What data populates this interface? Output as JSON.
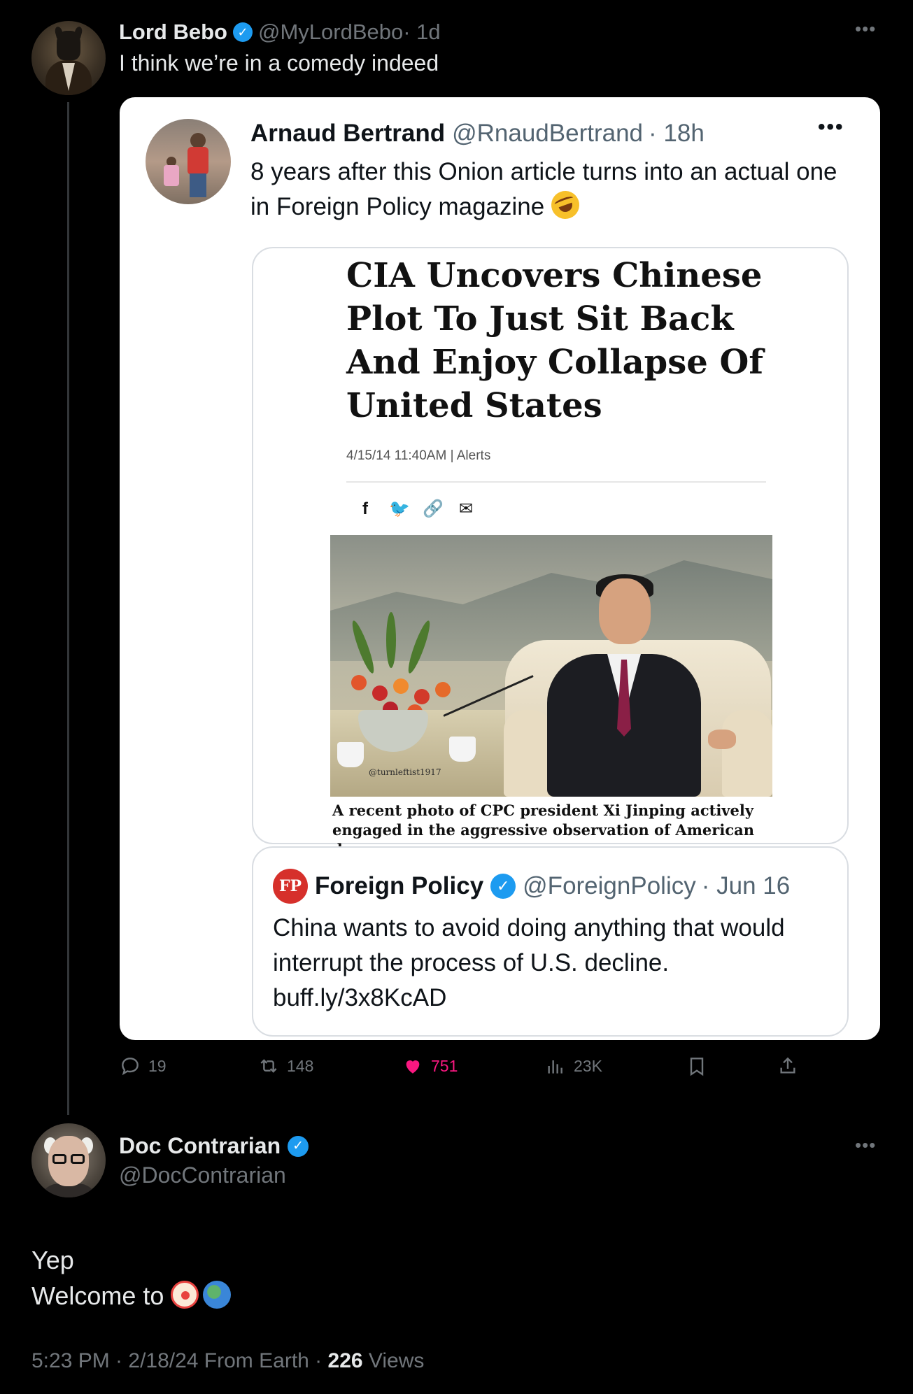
{
  "tweet": {
    "author": {
      "name": "Lord Bebo",
      "handle": "@MyLordBebo",
      "time": "· 1d",
      "verified": true
    },
    "text": "I think we’re in a comedy indeed",
    "more_icon": "more-horizontal-icon",
    "embedded_screenshot": {
      "author": {
        "name": "Arnaud Bertrand",
        "handle": "@RnaudBertrand",
        "time": "· 18h"
      },
      "more": "•••",
      "text": "8 years after this Onion article turns into an actual one in Foreign Policy magazine",
      "emoji": "rolling-on-floor-laughing",
      "onion_article": {
        "headline": "CIA Uncovers Chinese Plot To Just Sit Back And Enjoy Collapse Of United States",
        "meta": "4/15/14 11:40AM | Alerts",
        "share_icons": [
          "f",
          "🐦",
          "🔗",
          "✉"
        ],
        "photo_watermark": "@turnleftist1917",
        "caption": "A recent photo of CPC president Xi Jinping actively engaged in the aggressive observation of American decay."
      },
      "quoted": {
        "logo": "FP",
        "name": "Foreign Policy",
        "handle": "@ForeignPolicy",
        "time": "· Jun 16",
        "text": "China wants to avoid doing anything that would interrupt the process of U.S. decline.",
        "link": "buff.ly/3x8KcAD"
      }
    },
    "actions": {
      "replies": "19",
      "retweets": "148",
      "likes": "751",
      "views": "23K"
    },
    "colors": {
      "like": "#f91880",
      "verified": "#1d9bf0"
    }
  },
  "reply": {
    "author": {
      "name": "Doc Contrarian",
      "handle": "@DocContrarian",
      "verified": true
    },
    "text_line1": "Yep",
    "text_line2": "Welcome to",
    "emojis": [
      "clown-face",
      "globe"
    ],
    "meta": {
      "time": "5:23 PM · 2/18/24 From Earth · ",
      "views_count": "226",
      "views_label": " Views"
    }
  }
}
